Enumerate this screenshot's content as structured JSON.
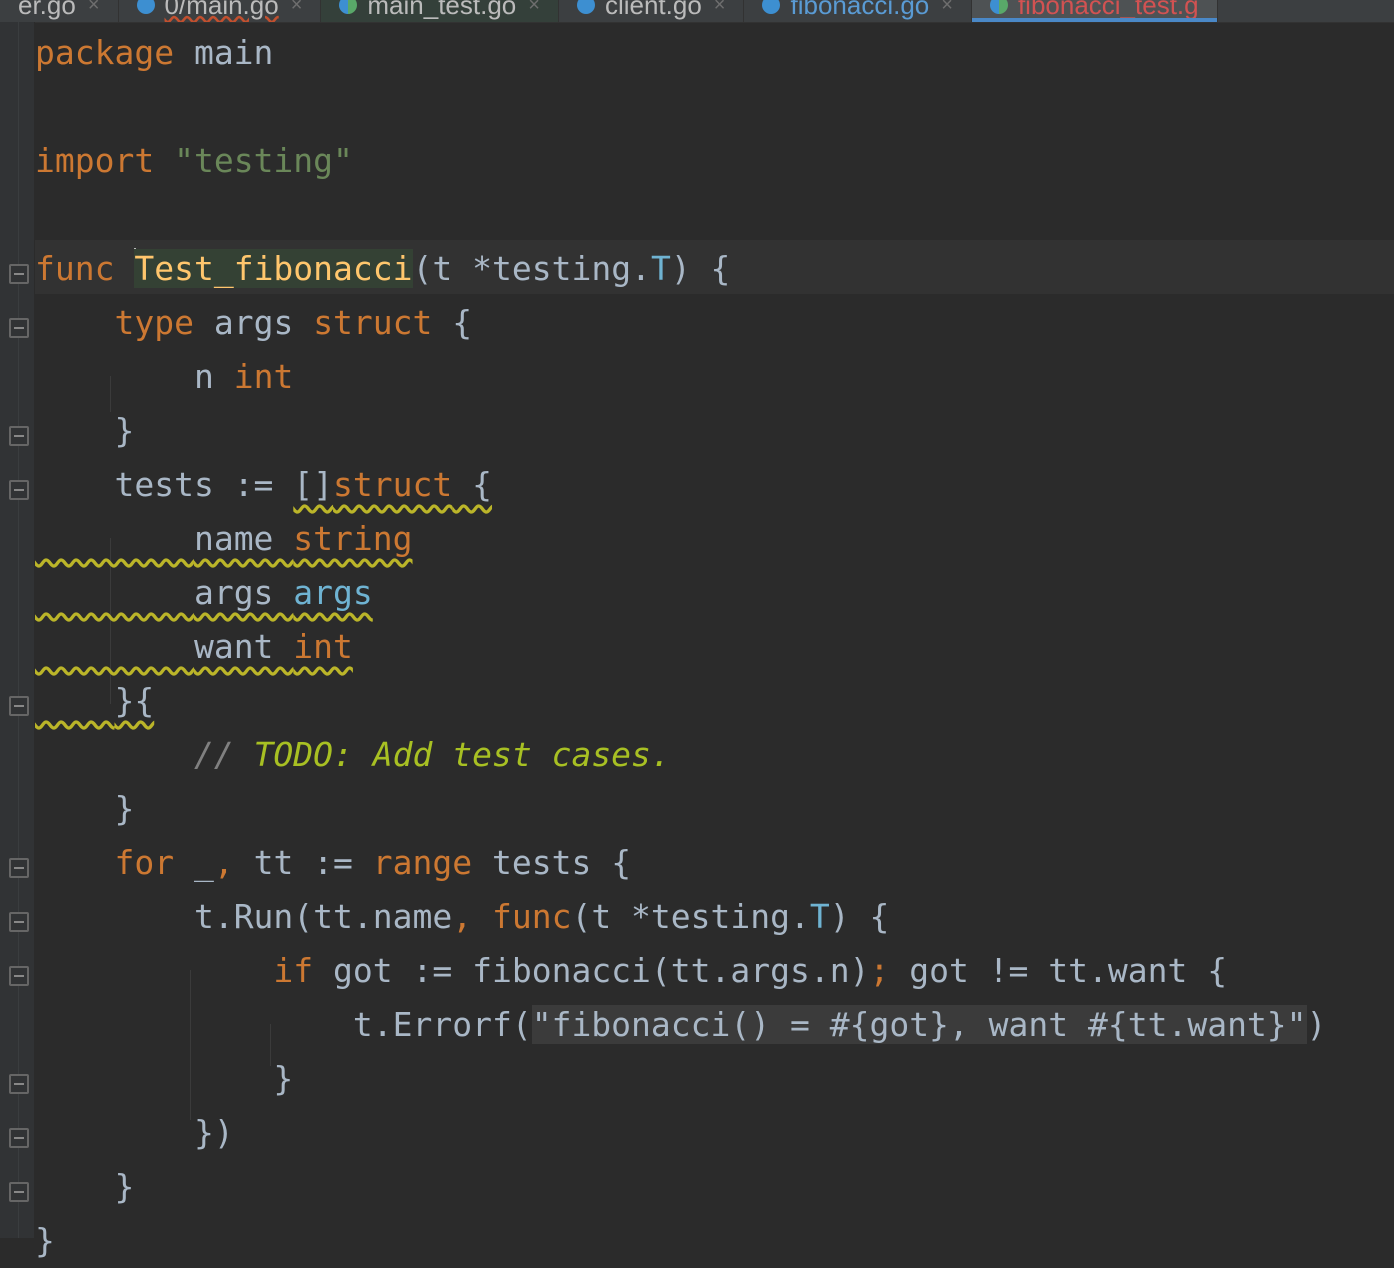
{
  "tabs": [
    {
      "label": "er.go",
      "icon": "go-file-icon",
      "state": "normal"
    },
    {
      "label": "0/main.go",
      "icon": "go-file-icon",
      "state": "error"
    },
    {
      "label": "main_test.go",
      "icon": "go-test-file-icon",
      "state": "selected"
    },
    {
      "label": "client.go",
      "icon": "go-file-icon",
      "state": "normal"
    },
    {
      "label": "fibonacci.go",
      "icon": "go-file-icon",
      "state": "modified"
    },
    {
      "label": "fibonacci_test.g",
      "icon": "go-test-file-icon",
      "state": "active"
    }
  ],
  "close_glyph": "×",
  "code": {
    "l1": {
      "kw": "package",
      "rest": " main"
    },
    "l3": {
      "kw": "import",
      "str": "\"testing\""
    },
    "l5": {
      "kw": "func",
      "name": "Test_fibonacci",
      "a": "(t *testing.",
      "T": "T",
      "b": ") {"
    },
    "l6": {
      "kw1": "type",
      "mid": " args ",
      "kw2": "struct",
      "end": " {"
    },
    "l7": {
      "a": "n ",
      "kw": "int"
    },
    "l8": {
      "text": "}"
    },
    "l9": {
      "a": "tests := ",
      "b": "[]",
      "kw": "struct",
      "c": " {"
    },
    "l10": {
      "a": "name ",
      "kw": "string"
    },
    "l11": {
      "a": "args ",
      "b": "args"
    },
    "l12": {
      "a": "want ",
      "kw": "int"
    },
    "l13": {
      "text": "}{"
    },
    "l14": {
      "cmt": "// ",
      "todo": "TODO: Add test cases."
    },
    "l15": {
      "text": "}"
    },
    "l16": {
      "kw1": "for",
      "a": " _",
      "comma": ",",
      "b": " tt := ",
      "kw2": "range",
      "c": " tests {"
    },
    "l17": {
      "a": "t.Run(tt.name",
      "comma": ",",
      "kw": " func",
      "b": "(t *testing.",
      "T": "T",
      "c": ") {"
    },
    "l18": {
      "kw": "if",
      "a": " got := fibonacci(tt.args.n)",
      "semi": ";",
      "b": " got != tt.want {"
    },
    "l19": {
      "a": "t.Errorf(",
      "str": "\"fibonacci() = #{got}, want #{tt.want}\"",
      "b": ")"
    },
    "l20": {
      "text": "}"
    },
    "l21": {
      "text": "})"
    },
    "l22": {
      "text": "}"
    },
    "l23": {
      "text": "}"
    }
  }
}
